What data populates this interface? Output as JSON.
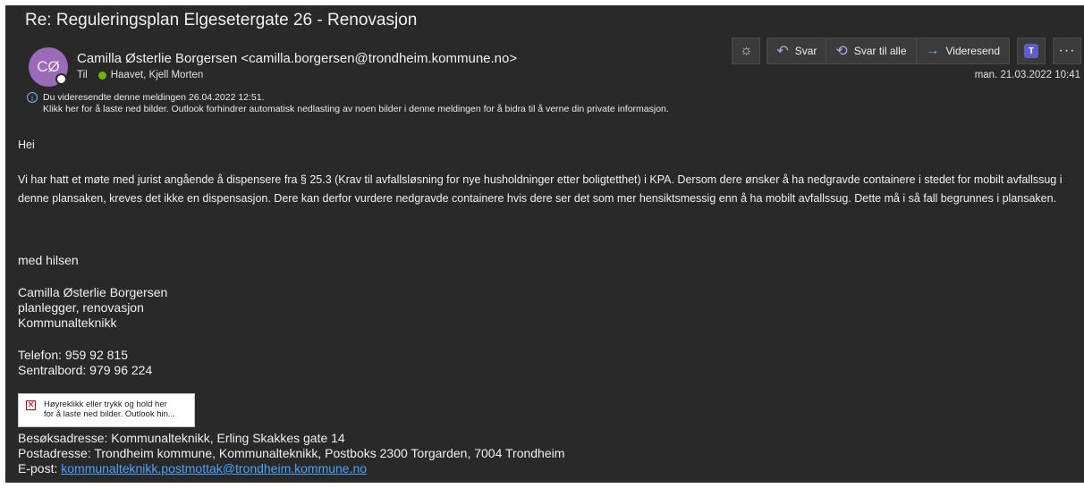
{
  "email": {
    "subject": "Re: Reguleringsplan Elgesetergate 26 - Renovasjon",
    "avatar_initials": "CØ",
    "sender": "Camilla Østerlie Borgersen <camilla.borgersen@trondheim.kommune.no>",
    "to_label": "Til",
    "to_name": "Haavet, Kjell Morten",
    "date": "man. 21.03.2022 10:41",
    "info_line1": "Du videresendte denne meldingen 26.04.2022 12:51.",
    "info_line2": "Klikk her for å laste ned bilder. Outlook forhindrer automatisk nedlasting av noen bilder i denne meldingen for å bidra til å verne din private informasjon."
  },
  "toolbar": {
    "reply": "Svar",
    "reply_all": "Svar til alle",
    "forward": "Videresend",
    "teams_letter": "T"
  },
  "body": {
    "greeting": "Hei",
    "paragraph": "Vi har hatt et møte med jurist angående å dispensere fra § 25.3 (Krav til avfallsløsning for nye husholdninger etter boligtetthet) i KPA. Dersom dere ønsker å ha nedgravde containere i stedet for mobilt avfallssug i denne plansaken, kreves det ikke en dispensasjon. Dere kan derfor vurdere nedgravde containere hvis dere ser det som mer hensiktsmessig enn å ha mobilt avfallssug. Dette må i så fall begrunnes i plansaken."
  },
  "signature": {
    "closing": "med hilsen",
    "name": "Camilla Østerlie Borgersen",
    "title": "planlegger, renovasjon",
    "department": "Kommunalteknikk",
    "phone": "Telefon: 959 92 815",
    "switchboard": "Sentralbord: 979 96 224",
    "broken_image_line1": "Høyreklikk eller trykk og hold her",
    "broken_image_line2": "for å laste ned bilder. Outlook hin...",
    "visit_address": "Besøksadresse: Kommunalteknikk, Erling Skakkes gate 14",
    "post_address": "Postadresse: Trondheim kommune, Kommunalteknikk, Postboks 2300 Torgarden, 7004 Trondheim",
    "email_label": "E-post:",
    "email_link": "kommunalteknikk.postmottak@trondheim.kommune.no"
  },
  "colors": {
    "background": "#292929",
    "avatar": "#9b6bb8",
    "presence_available": "#6bb700",
    "link": "#4aa3ff",
    "icon_accent": "#bba6e8",
    "teams": "#5b5fc7"
  },
  "icons": [
    "sun-icon",
    "reply-icon",
    "reply-all-icon",
    "forward-icon",
    "teams-icon",
    "more-icon",
    "info-icon",
    "broken-image-icon"
  ]
}
